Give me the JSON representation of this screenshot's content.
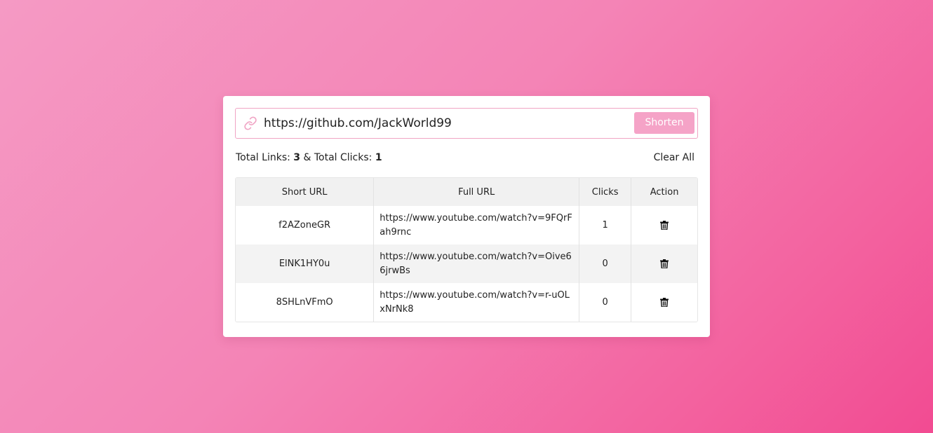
{
  "input": {
    "value": "https://github.com/JackWorld99",
    "button_label": "Shorten"
  },
  "stats": {
    "links_label": "Total Links:",
    "links_count": "3",
    "separator": "& Total Clicks:",
    "clicks_count": "1"
  },
  "clear_all_label": "Clear All",
  "table": {
    "headers": [
      "Short URL",
      "Full URL",
      "Clicks",
      "Action"
    ],
    "rows": [
      {
        "short": "f2AZoneGR",
        "full": "https://www.youtube.com/watch?v=9FQrFah9rnc",
        "clicks": "1"
      },
      {
        "short": "ElNK1HY0u",
        "full": "https://www.youtube.com/watch?v=Oive66jrwBs",
        "clicks": "0"
      },
      {
        "short": "8SHLnVFmO",
        "full": "https://www.youtube.com/watch?v=r-uOLxNrNk8",
        "clicks": "0"
      }
    ]
  },
  "colors": {
    "accent": "#f5a3c7",
    "background_start": "#f59ac4",
    "background_end": "#f24b92"
  },
  "icons": {
    "input_icon": "link-icon",
    "action_icon": "trash-icon"
  }
}
